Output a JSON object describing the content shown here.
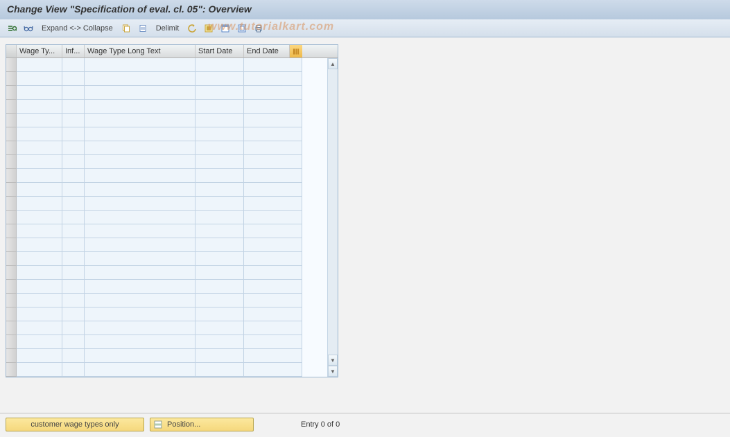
{
  "header": {
    "title": "Change View \"Specification of eval. cl. 05\": Overview"
  },
  "toolbar": {
    "expand_collapse": "Expand <-> Collapse",
    "delimit": "Delimit",
    "icons": {
      "details": "details-icon",
      "glasses": "glasses-icon",
      "copy": "copy-icon",
      "delete": "delete-icon",
      "undo": "undo-icon",
      "select_all": "select-all-icon",
      "select_block": "select-block-icon",
      "deselect_all": "deselect-all-icon",
      "print": "print-icon"
    }
  },
  "table": {
    "columns": {
      "col1": "Wage Ty...",
      "col2": "Inf...",
      "col3": "Wage Type Long Text",
      "col4": "Start Date",
      "col5": "End Date"
    },
    "empty_rows": 23
  },
  "footer": {
    "customer_btn": "customer wage types only",
    "position_btn": "Position...",
    "entry_text": "Entry 0 of 0"
  },
  "watermark": "www.tutorialkart.com"
}
